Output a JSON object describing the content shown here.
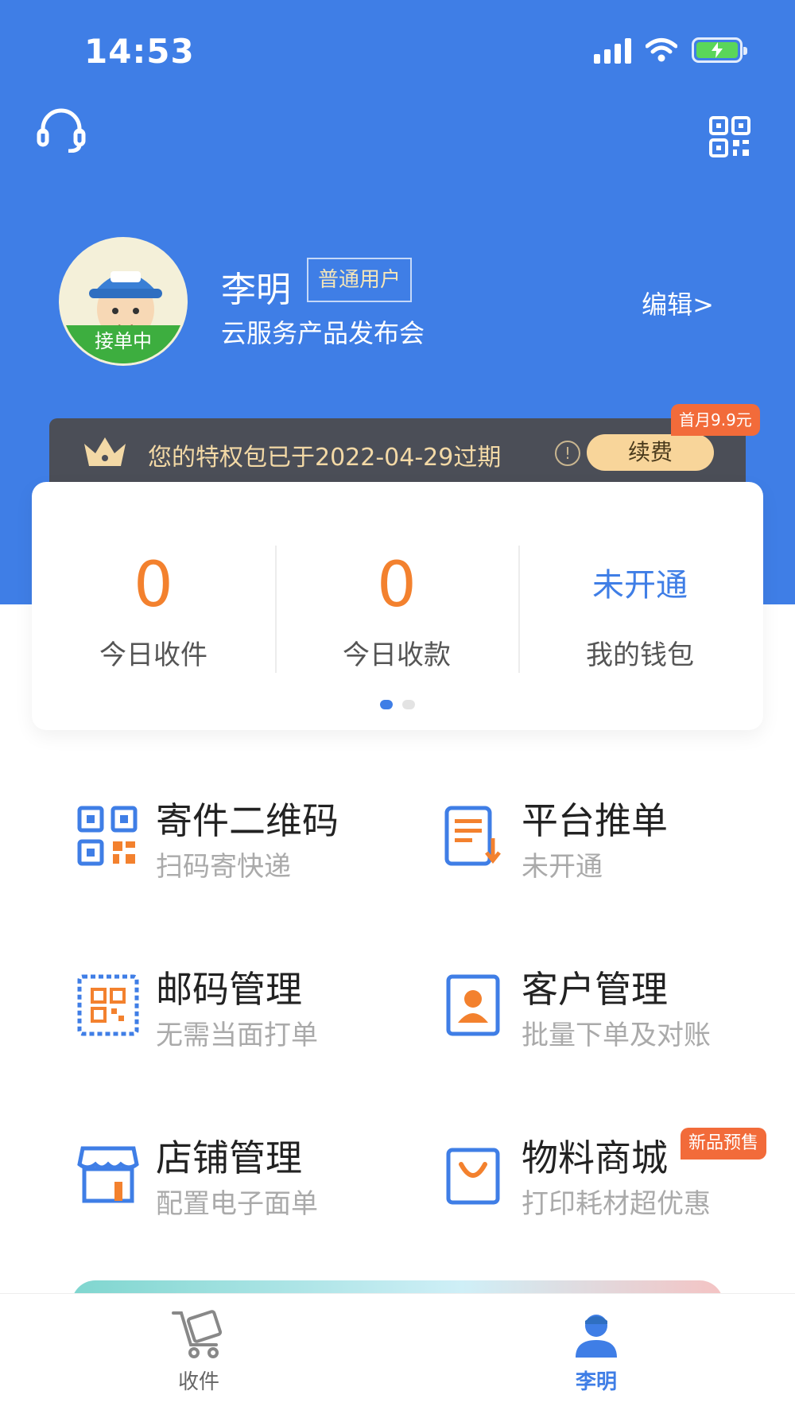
{
  "status_bar": {
    "time": "14:53"
  },
  "profile": {
    "avatar_badge": "接单中",
    "name": "李明",
    "user_type": "普通用户",
    "company": "云服务产品发布会",
    "edit_label": "编辑>"
  },
  "privilege": {
    "message": "您的特权包已于2022-04-29过期",
    "renew_label": "续费",
    "promo_tag": "首月9.9元"
  },
  "stats": [
    {
      "value": "0",
      "label": "今日收件"
    },
    {
      "value": "0",
      "label": "今日收款"
    },
    {
      "value": "未开通",
      "label": "我的钱包"
    }
  ],
  "menu": [
    {
      "title": "寄件二维码",
      "subtitle": "扫码寄快递",
      "icon": "qr-code-icon"
    },
    {
      "title": "平台推单",
      "subtitle": "未开通",
      "icon": "document-download-icon"
    },
    {
      "title": "邮码管理",
      "subtitle": "无需当面打单",
      "icon": "stamp-qr-icon"
    },
    {
      "title": "客户管理",
      "subtitle": "批量下单及对账",
      "icon": "contact-card-icon"
    },
    {
      "title": "店铺管理",
      "subtitle": "配置电子面单",
      "icon": "store-icon"
    },
    {
      "title": "物料商城",
      "subtitle": "打印耗材超优惠",
      "icon": "shopping-bag-icon",
      "tag": "新品预售"
    }
  ],
  "bottom_nav": [
    {
      "label": "收件",
      "icon": "cart-icon",
      "active": false
    },
    {
      "label": "李明",
      "icon": "user-icon",
      "active": true
    }
  ],
  "colors": {
    "primary": "#3f7ee6",
    "accent_orange": "#f3812e",
    "promo_red": "#f26b3a"
  }
}
